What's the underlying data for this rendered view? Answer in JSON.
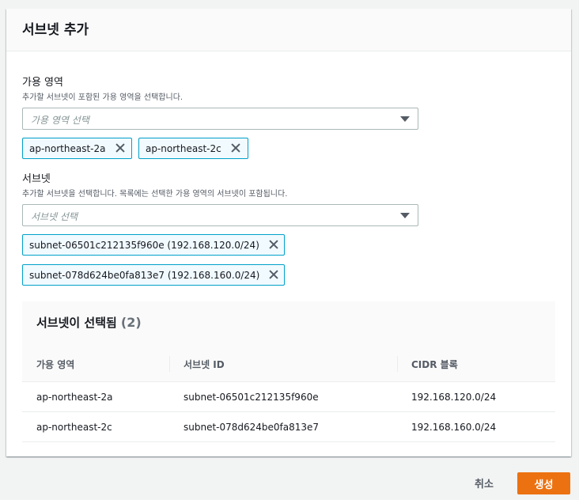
{
  "panel": {
    "title": "서브넷 추가"
  },
  "az_field": {
    "label": "가용 영역",
    "description": "추가할 서브넷이 포함된 가용 영역을 선택합니다.",
    "placeholder": "가용 영역 선택",
    "tokens": [
      "ap-northeast-2a",
      "ap-northeast-2c"
    ]
  },
  "subnet_field": {
    "label": "서브넷",
    "description": "추가할 서브넷을 선택합니다. 목록에는 선택한 가용 영역의 서브넷이 포함됩니다.",
    "placeholder": "서브넷 선택",
    "tokens": [
      "subnet-06501c212135f960e (192.168.120.0/24)",
      "subnet-078d624be0fa813e7 (192.168.160.0/24)"
    ]
  },
  "selected_table": {
    "title": "서브넷이 선택됨",
    "count": "(2)",
    "columns": [
      "가용 영역",
      "서브넷 ID",
      "CIDR 블록"
    ],
    "rows": [
      [
        "ap-northeast-2a",
        "subnet-06501c212135f960e",
        "192.168.120.0/24"
      ],
      [
        "ap-northeast-2c",
        "subnet-078d624be0fa813e7",
        "192.168.160.0/24"
      ]
    ]
  },
  "footer": {
    "cancel_label": "취소",
    "create_label": "생성"
  },
  "colors": {
    "primary_button": "#ec7211",
    "token_border": "#00a1c9",
    "token_background": "#f1faff"
  },
  "icons": {
    "dropdown": "caret-down-icon",
    "dismiss": "close-icon"
  }
}
